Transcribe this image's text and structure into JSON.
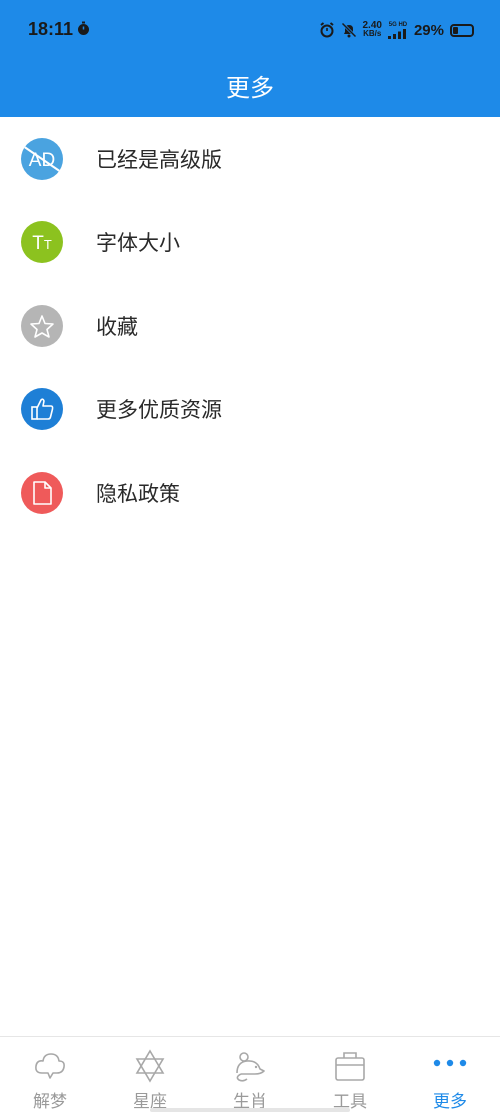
{
  "status_bar": {
    "time": "18:11",
    "net_speed_value": "2.40",
    "net_speed_unit": "KB/s",
    "network_type": "5G HD",
    "battery_percent": "29%",
    "battery_level": 0.29
  },
  "header": {
    "title": "更多",
    "background_color": "#1e8ae8"
  },
  "menu": {
    "items": [
      {
        "label": "已经是高级版",
        "icon": "no-ads-icon",
        "icon_text": "AD",
        "color": "#4aa3e0"
      },
      {
        "label": "字体大小",
        "icon": "font-size-icon",
        "icon_text": "TT",
        "color": "#8cc21f"
      },
      {
        "label": "收藏",
        "icon": "star-icon",
        "color": "#b5b5b5"
      },
      {
        "label": "更多优质资源",
        "icon": "thumbs-up-icon",
        "color": "#1e7fd6"
      },
      {
        "label": "隐私政策",
        "icon": "document-icon",
        "color": "#ef5a5a"
      }
    ]
  },
  "tabbar": {
    "tabs": [
      {
        "label": "解梦",
        "icon": "cloud-icon",
        "active": false
      },
      {
        "label": "星座",
        "icon": "hexagram-icon",
        "active": false
      },
      {
        "label": "生肖",
        "icon": "mouse-icon",
        "active": false
      },
      {
        "label": "工具",
        "icon": "toolbox-icon",
        "active": false
      },
      {
        "label": "更多",
        "icon": "more-dots-icon",
        "active": true
      }
    ],
    "active_color": "#1e8ae8",
    "inactive_color": "#9a9a9a"
  }
}
